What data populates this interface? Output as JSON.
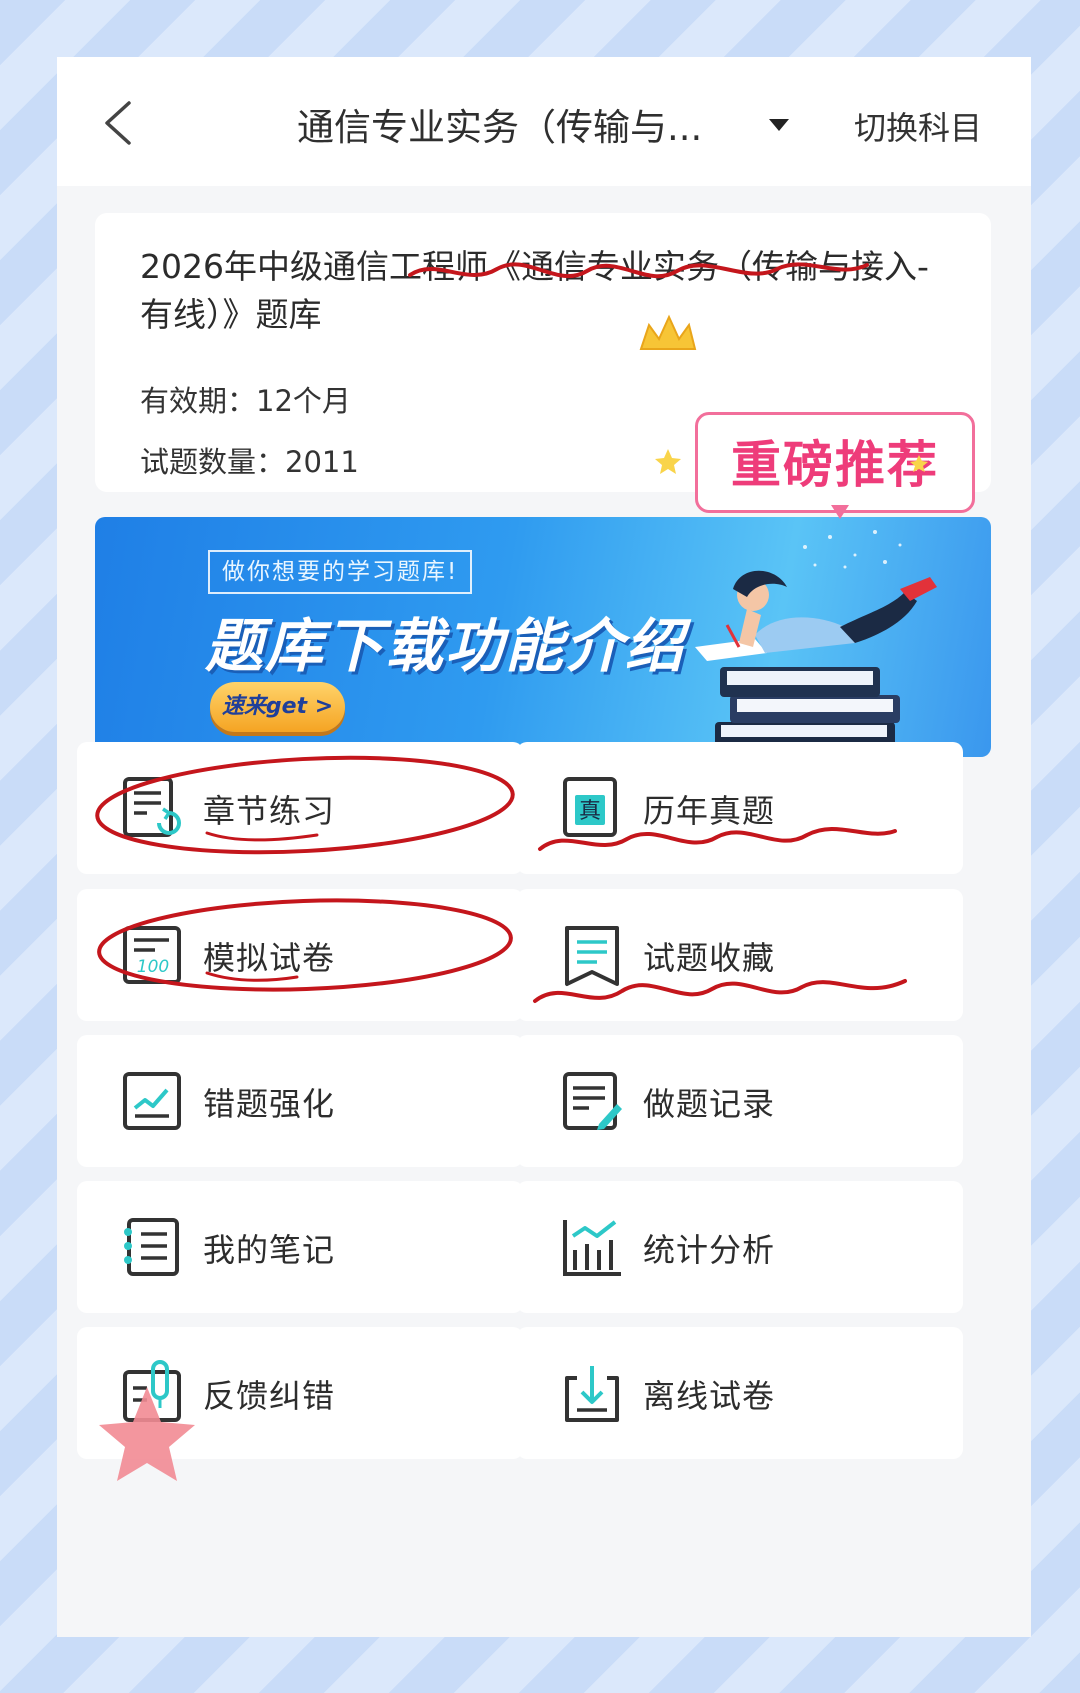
{
  "header": {
    "title": "通信专业实务（传输与...",
    "switch_label": "切换科目"
  },
  "info": {
    "bank_title": "2026年中级通信工程师《通信专业实务（传输与接入-有线）》题库",
    "validity": "有效期：12个月",
    "question_count": "试题数量：2011"
  },
  "badge": {
    "recommend": "重磅推荐"
  },
  "banner": {
    "tag": "做你想要的学习题库!",
    "title": "题库下载功能介绍",
    "button": "速来get >"
  },
  "menu": [
    {
      "label": "章节练习",
      "icon": "chapter-practice-icon"
    },
    {
      "label": "历年真题",
      "icon": "past-exam-icon"
    },
    {
      "label": "模拟试卷",
      "icon": "mock-paper-icon"
    },
    {
      "label": "试题收藏",
      "icon": "bookmark-icon"
    },
    {
      "label": "错题强化",
      "icon": "wrong-question-icon"
    },
    {
      "label": "做题记录",
      "icon": "record-icon"
    },
    {
      "label": "我的笔记",
      "icon": "notes-icon"
    },
    {
      "label": "统计分析",
      "icon": "statistics-icon"
    },
    {
      "label": "反馈纠错",
      "icon": "feedback-icon"
    },
    {
      "label": "离线试卷",
      "icon": "download-icon"
    }
  ],
  "colors": {
    "accent": "#2dc8c8",
    "annotation_red": "#c4161c",
    "badge_pink": "#ee3c7a"
  }
}
